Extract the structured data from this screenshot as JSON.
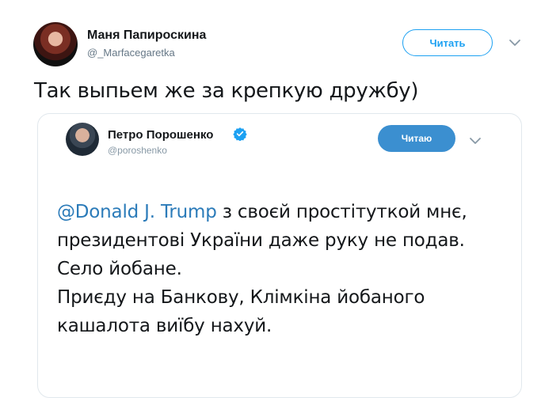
{
  "tweet": {
    "author_name": "Маня Папироскина",
    "author_handle": "@_Marfacegaretka",
    "follow_label": "Читать",
    "text": "Так выпьем же за крепкую дружбу)"
  },
  "quoted_tweet": {
    "author_name": "Петро Порошенко",
    "author_handle": "@poroshenko",
    "verified": true,
    "follow_label": "Читаю",
    "mention": "@Donald J. Trump",
    "line1_rest": " з своєй простітуткой мнє,",
    "line2": "президентові України даже руку не подав.",
    "line3": "Село йобане.",
    "line4": "Приєду на Банкову, Клімкіна йобаного",
    "line5": "кашалота виїбу нахуй."
  },
  "colors": {
    "accent": "#1da1f2",
    "following_button": "#3b8fd0",
    "mention": "#2b7bb9",
    "secondary_text": "#657786"
  },
  "icons": [
    "chevron-down-icon",
    "verified-badge-icon"
  ]
}
